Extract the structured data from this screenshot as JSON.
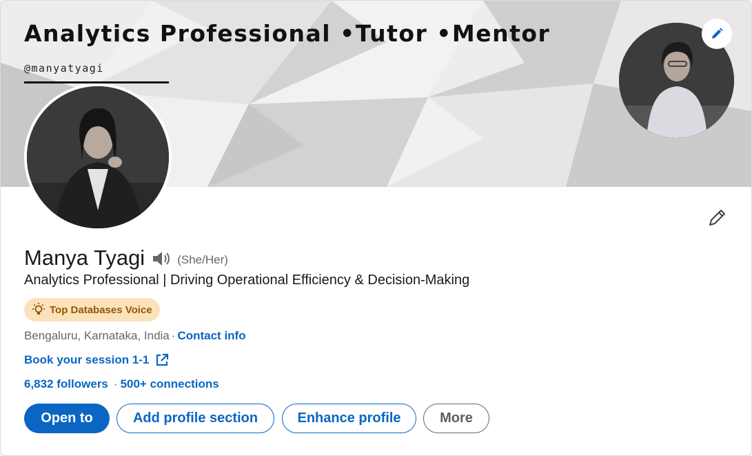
{
  "banner": {
    "headline": "Analytics Professional •Tutor •Mentor",
    "handle": "@manyatyagi"
  },
  "profile": {
    "name": "Manya Tyagi",
    "pronouns": "(She/Her)",
    "headline": "Analytics Professional | Driving Operational Efficiency & Decision-Making",
    "badge": "Top Databases Voice",
    "location": "Bengaluru, Karnataka, India",
    "location_separator": "·",
    "contact_info": "Contact info",
    "custom_link": "Book your session 1-1",
    "followers": "6,832 followers",
    "stats_separator": "·",
    "connections": "500+ connections"
  },
  "actions": {
    "open_to": "Open to",
    "add_section": "Add profile section",
    "enhance": "Enhance profile",
    "more": "More"
  },
  "icons": {
    "banner_edit": "pencil-icon",
    "intro_edit": "pencil-icon",
    "pronunciation": "speaker-icon",
    "badge": "lightbulb-icon",
    "external": "external-link-icon"
  },
  "colors": {
    "accent": "#0a66c2",
    "badge_bg": "#fce2ba",
    "badge_text": "#915907",
    "muted": "#666666"
  }
}
